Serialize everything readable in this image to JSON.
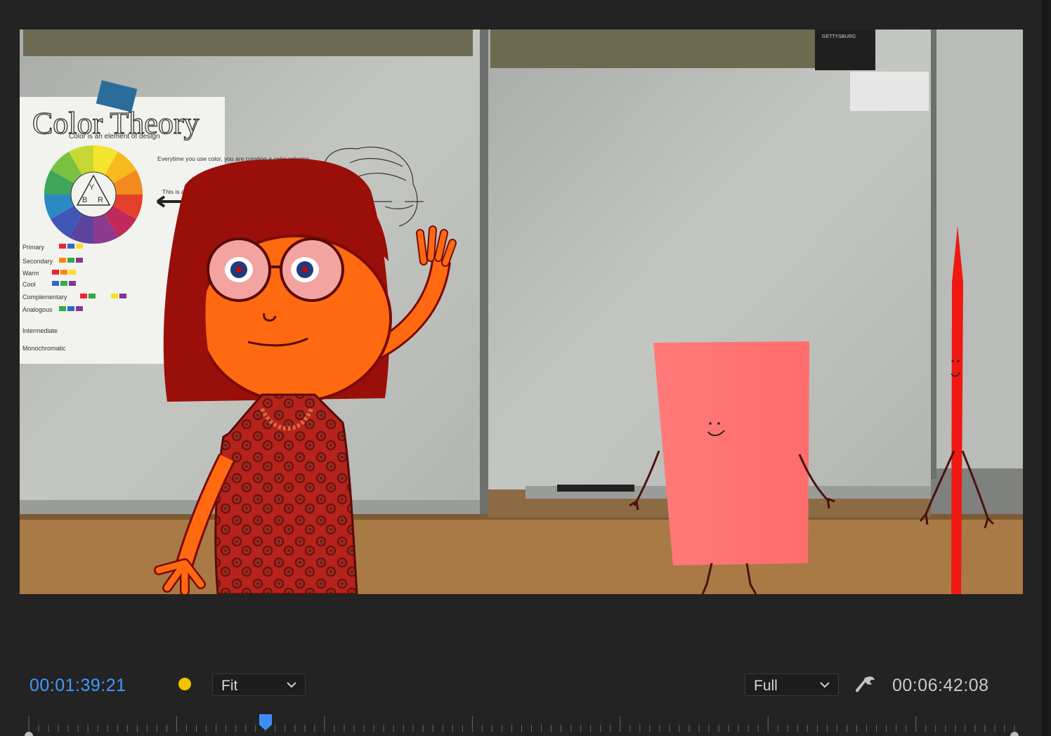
{
  "viewer": {
    "poster": {
      "title": "Color Theory",
      "subtitle": "Color is an element of design",
      "note": "Everytime you use color, you are creating a color scheme.",
      "arrow_note": "This is a color wheel",
      "wheel_letters": [
        "Y",
        "B",
        "R"
      ],
      "rows": [
        "Primary",
        "Secondary",
        "Warm",
        "Cool",
        "Complementary",
        "Analogous",
        "Intermediate",
        "Monochromatic"
      ]
    },
    "notice_brand": "GETTYSBURG"
  },
  "controls": {
    "current_timecode": "00:01:39:21",
    "zoom_value": "Fit",
    "resolution_value": "Full",
    "duration_timecode": "00:06:42:08"
  },
  "colors": {
    "accent": "#3f9bff",
    "marker_dot": "#f2c100",
    "panel_bg": "#232323"
  },
  "icons": {
    "zoom_chevron": "chevron-down-icon",
    "resolution_chevron": "chevron-down-icon",
    "settings": "wrench-icon",
    "playhead": "playhead-icon"
  }
}
